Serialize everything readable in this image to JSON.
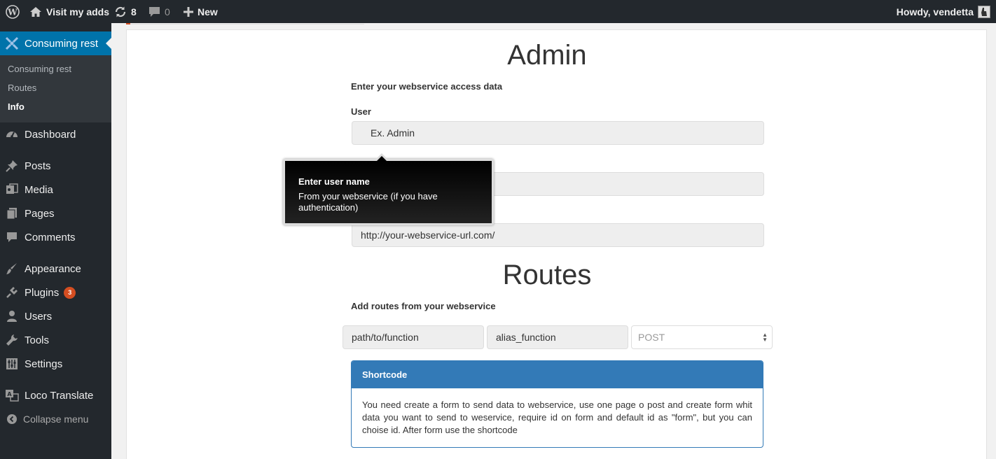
{
  "adminbar": {
    "site_name": "Visit my adds",
    "updates_count": "8",
    "comments_count": "0",
    "new_label": "New",
    "howdy": "Howdy, vendetta"
  },
  "sidebar": {
    "current_menu": "Consuming rest",
    "submenu": [
      "Consuming rest",
      "Routes",
      "Info"
    ],
    "items": [
      {
        "label": "Dashboard",
        "icon": "dashboard-icon"
      },
      {
        "label": "Posts",
        "icon": "pin-icon"
      },
      {
        "label": "Media",
        "icon": "media-icon"
      },
      {
        "label": "Pages",
        "icon": "pages-icon"
      },
      {
        "label": "Comments",
        "icon": "comment-icon"
      },
      {
        "label": "Appearance",
        "icon": "brush-icon"
      },
      {
        "label": "Plugins",
        "icon": "plugin-icon",
        "badge": "3"
      },
      {
        "label": "Users",
        "icon": "user-icon"
      },
      {
        "label": "Tools",
        "icon": "wrench-icon"
      },
      {
        "label": "Settings",
        "icon": "settings-icon"
      },
      {
        "label": "Loco Translate",
        "icon": "translate-icon"
      }
    ],
    "collapse_label": "Collapse menu"
  },
  "admin": {
    "title": "Admin",
    "intro": "Enter your webservice access data",
    "user_label": "User",
    "user_placeholder": "Ex. Admin",
    "url_value": "http://your-webservice-url.com/"
  },
  "tooltip": {
    "title": "Enter user name",
    "text": "From your webservice (if you have authentication)"
  },
  "routes": {
    "title": "Routes",
    "intro": "Add routes from your webservice",
    "path_placeholder": "path/to/function",
    "alias_placeholder": "alias_function",
    "method_selected": "POST"
  },
  "shortcode": {
    "heading": "Shortcode",
    "body": "You need create a form to send data to webservice, use one page o post and create form whit data you want to send to weservice, require id on form and default id as \"form\", but you can choise id. After form use the shortcode"
  },
  "colors": {
    "adminbar_bg": "#23282d",
    "menu_current_bg": "#0073aa",
    "panel_header_bg": "#337ab7",
    "badge_bg": "#d54e21"
  }
}
